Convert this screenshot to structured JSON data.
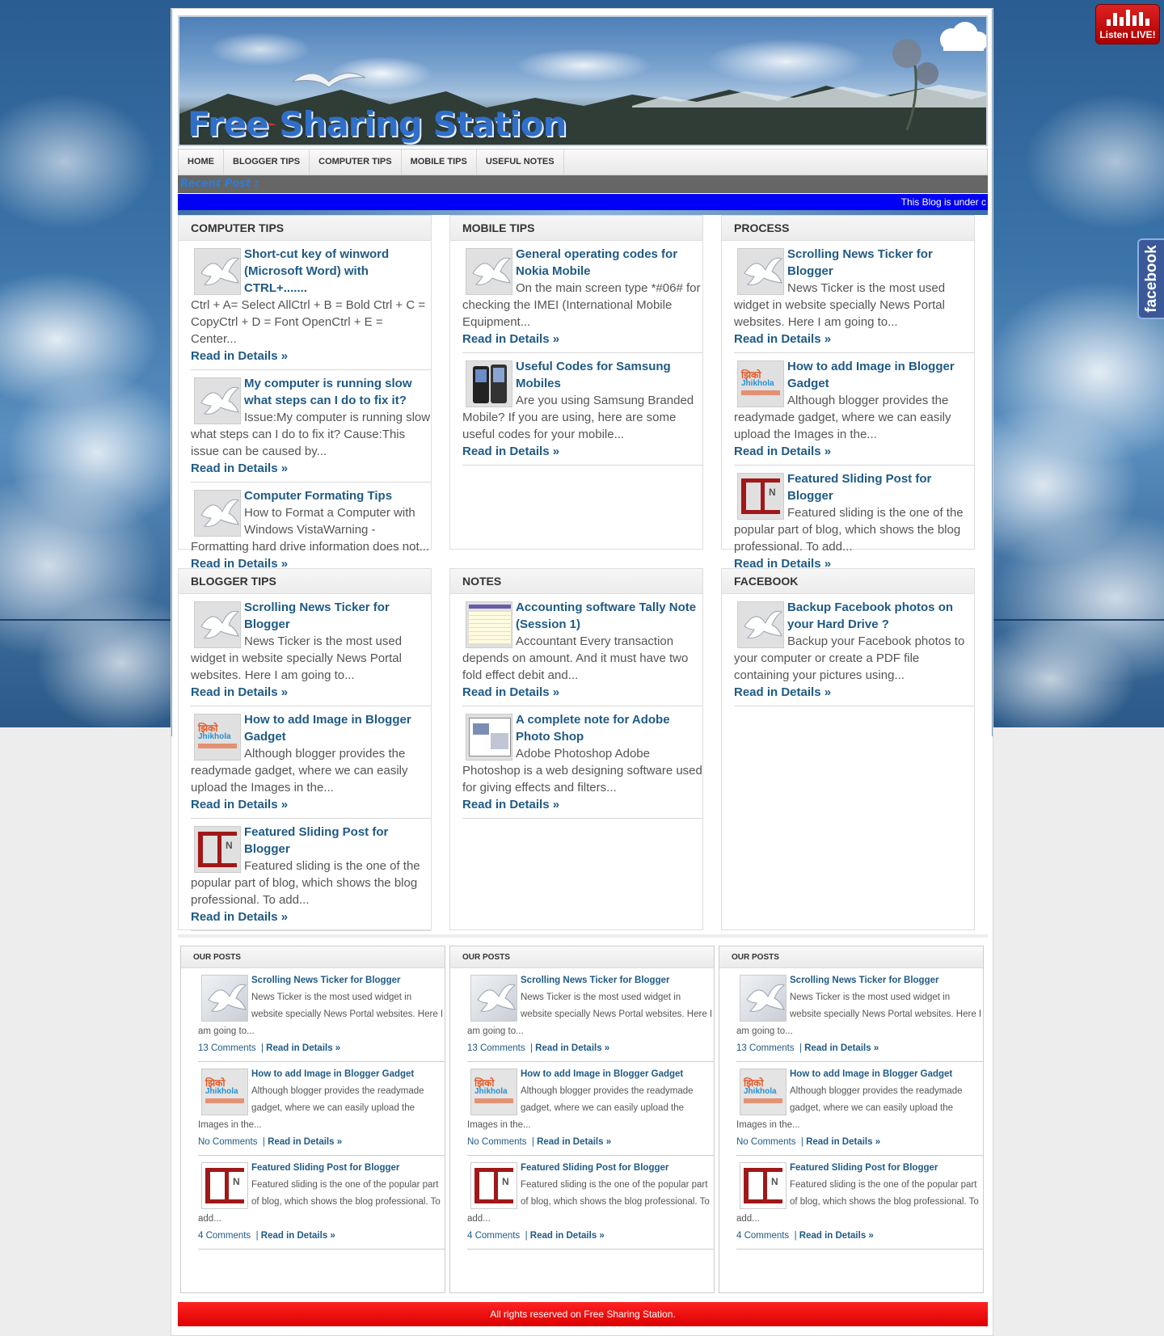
{
  "badge": {
    "listen_label": "Listen LIVE!"
  },
  "facebook_tab": {
    "label": "facebook"
  },
  "header": {
    "site_title": "Free Sharing Station"
  },
  "nav": {
    "items": [
      "HOME",
      "BLOGGER TIPS",
      "COMPUTER TIPS",
      "MOBILE TIPS",
      "USEFUL NOTES"
    ]
  },
  "recent": {
    "label": "Recent Post :",
    "ticker_text": "This Blog is under c"
  },
  "read_more": "Read in Details »",
  "categories": [
    {
      "title": "COMPUTER TIPS",
      "posts": [
        {
          "title": "Short-cut key of winword (Microsoft Word) with CTRL+.......",
          "excerpt": "Ctrl + A= Select AllCtrl + B = Bold Ctrl + C = CopyCtrl + D = Font OpenCtrl + E = Center...",
          "thumb": "dove"
        },
        {
          "title": "My computer is running slow what steps can I do to fix it?",
          "excerpt": "Issue:My computer is running slow what steps can I do to fix it? Cause:This issue can be caused by...",
          "thumb": "dove"
        },
        {
          "title": "Computer Formating Tips",
          "excerpt": "How to Format a Computer with Windows VistaWarning - Formatting hard drive information does not...",
          "thumb": "dove"
        }
      ]
    },
    {
      "title": "MOBILE TIPS",
      "posts": [
        {
          "title": "General operating codes for Nokia Mobile",
          "excerpt": "On the main screen type *#06# for checking the IMEI (International Mobile Equipment...",
          "thumb": "dove"
        },
        {
          "title": "Useful Codes for Samsung Mobiles",
          "excerpt": "Are you using Samsung Branded Mobile? If you are using, here are some useful codes for your mobile...",
          "thumb": "phone"
        }
      ]
    },
    {
      "title": "PROCESS",
      "posts": [
        {
          "title": "Scrolling News Ticker for Blogger",
          "excerpt": "News Ticker is the most used widget in website specially News Portal websites. Here I am going to...",
          "thumb": "dove"
        },
        {
          "title": "How to add Image in Blogger Gadget",
          "excerpt": "Although blogger provides the readymade gadget, where we can easily upload the Images in the...",
          "thumb": "logo"
        },
        {
          "title": "Featured Sliding Post for Blogger",
          "excerpt": "Featured sliding is the one of the popular part of blog, which shows the blog professional. To add...",
          "thumb": "slide"
        }
      ]
    },
    {
      "title": "BLOGGER TIPS",
      "posts": [
        {
          "title": "Scrolling News Ticker for Blogger",
          "excerpt": "News Ticker is the most used widget in website specially News Portal websites. Here I am going to...",
          "thumb": "dove"
        },
        {
          "title": "How to add Image in Blogger Gadget",
          "excerpt": "Although blogger provides the readymade gadget, where we can easily upload the Images in the...",
          "thumb": "logo"
        },
        {
          "title": "Featured Sliding Post for Blogger",
          "excerpt": "Featured sliding is the one of the popular part of blog, which shows the blog professional. To add...",
          "thumb": "slide"
        }
      ]
    },
    {
      "title": "NOTES",
      "posts": [
        {
          "title": "Accounting software Tally Note (Session 1)",
          "excerpt": "Accountant Every transaction depends on amount. And it must have two fold effect debit and...",
          "thumb": "tally"
        },
        {
          "title": "A complete note for Adobe Photo Shop",
          "excerpt": "Adobe Photoshop Adobe Photoshop is a web designing software used for giving effects and filters...",
          "thumb": "ps"
        }
      ]
    },
    {
      "title": "FACEBOOK",
      "posts": [
        {
          "title": "Backup Facebook photos on your Hard Drive ?",
          "excerpt": "Backup your Facebook photos to your computer or create a PDF file containing your pictures using...",
          "thumb": "dove"
        }
      ]
    }
  ],
  "our_posts": {
    "title": "OUR POSTS",
    "posts": [
      {
        "title": "Scrolling News Ticker for Blogger",
        "excerpt": "News Ticker is the most used widget in website specially News Portal websites. Here I am going to...",
        "comments": "13 Comments",
        "thumb": "dove"
      },
      {
        "title": "How to add Image in Blogger Gadget",
        "excerpt": "Although blogger provides the readymade gadget, where we can easily upload the Images in the...",
        "comments": "No Comments",
        "thumb": "logo"
      },
      {
        "title": "Featured Sliding Post for Blogger",
        "excerpt": "Featured sliding is the one of the popular part of blog, which shows the blog professional. To add...",
        "comments": "4 Comments",
        "thumb": "slide"
      }
    ]
  },
  "footer": {
    "text": "All rights reserved on Free Sharing Station."
  }
}
